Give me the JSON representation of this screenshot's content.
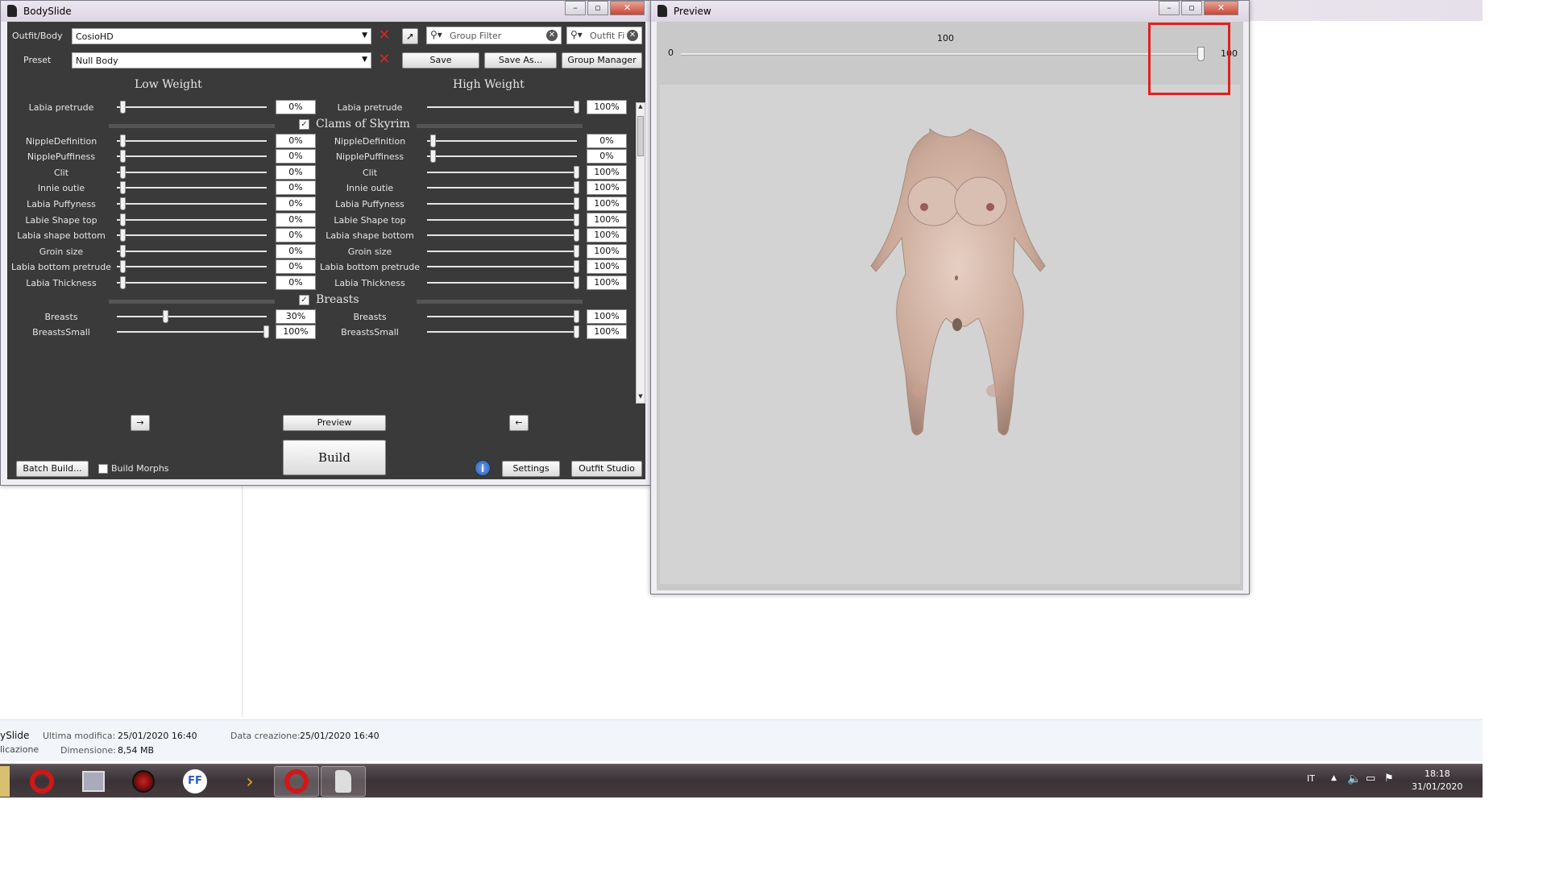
{
  "bodyslide": {
    "title": "BodySlide",
    "outfit_label": "Outfit/Body",
    "outfit_value": "CosioHD",
    "preset_label": "Preset",
    "preset_value": "Null Body",
    "group_filter_placeholder": "Group Filter",
    "outfit_filter_placeholder": "Outfit Fi",
    "save_label": "Save",
    "save_as_label": "Save As...",
    "group_manager_label": "Group Manager",
    "low_weight_label": "Low Weight",
    "high_weight_label": "High Weight",
    "rows": [
      {
        "type": "slider",
        "name": "Labia pretrude",
        "low": 0,
        "low_text": "0%",
        "high": 100,
        "high_text": "100%"
      },
      {
        "type": "group",
        "name": "Clams of Skyrim",
        "checked": true
      },
      {
        "type": "slider",
        "name": "NippleDefinition",
        "low": 0,
        "low_text": "0%",
        "high": 0,
        "high_text": "0%"
      },
      {
        "type": "slider",
        "name": "NipplePuffiness",
        "low": 0,
        "low_text": "0%",
        "high": 0,
        "high_text": "0%"
      },
      {
        "type": "slider",
        "name": "Clit",
        "low": 0,
        "low_text": "0%",
        "high": 100,
        "high_text": "100%"
      },
      {
        "type": "slider",
        "name": "Innie outie",
        "low": 0,
        "low_text": "0%",
        "high": 100,
        "high_text": "100%"
      },
      {
        "type": "slider",
        "name": "Labia Puffyness",
        "low": 0,
        "low_text": "0%",
        "high": 100,
        "high_text": "100%"
      },
      {
        "type": "slider",
        "name": "Labie Shape top",
        "low": 0,
        "low_text": "0%",
        "high": 100,
        "high_text": "100%"
      },
      {
        "type": "slider",
        "name": "Labia shape bottom",
        "low": 0,
        "low_text": "0%",
        "high": 100,
        "high_text": "100%"
      },
      {
        "type": "slider",
        "name": "Groin size",
        "low": 0,
        "low_text": "0%",
        "high": 100,
        "high_text": "100%"
      },
      {
        "type": "slider",
        "name": "Labia bottom pretrude",
        "low": 0,
        "low_text": "0%",
        "high": 100,
        "high_text": "100%"
      },
      {
        "type": "slider",
        "name": "Labia Thickness",
        "low": 0,
        "low_text": "0%",
        "high": 100,
        "high_text": "100%"
      },
      {
        "type": "group",
        "name": "Breasts",
        "checked": true
      },
      {
        "type": "slider",
        "name": "Breasts",
        "low": 30,
        "low_text": "30%",
        "high": 100,
        "high_text": "100%"
      },
      {
        "type": "slider",
        "name": "BreastsSmall",
        "low": 100,
        "low_text": "100%",
        "high": 100,
        "high_text": "100%"
      }
    ],
    "arrow_right": "→",
    "arrow_left": "←",
    "preview_label": "Preview",
    "build_label": "Build",
    "batch_build_label": "Batch Build...",
    "build_morphs_label": "Build Morphs",
    "settings_label": "Settings",
    "outfit_studio_label": "Outfit Studio"
  },
  "preview": {
    "title": "Preview",
    "slider_min": "0",
    "slider_max": "100",
    "slider_value": "100",
    "slider_value_label": "100",
    "slider_level": 100
  },
  "explorer": {
    "name_fragment": "ySlide",
    "type_fragment": "licazione",
    "modified_label": "Ultima modifica:",
    "modified_value": "25/01/2020 16:40",
    "created_label": "Data creazione:",
    "created_value": "25/01/2020 16:40",
    "size_label": "Dimensione:",
    "size_value": "8,54 MB"
  },
  "taskbar": {
    "lang": "IT",
    "time": "18:18",
    "date": "31/01/2020",
    "ffdec_label": "FF"
  },
  "colors": {
    "highlight": "#e02020",
    "panel": "#3a3a3a"
  }
}
